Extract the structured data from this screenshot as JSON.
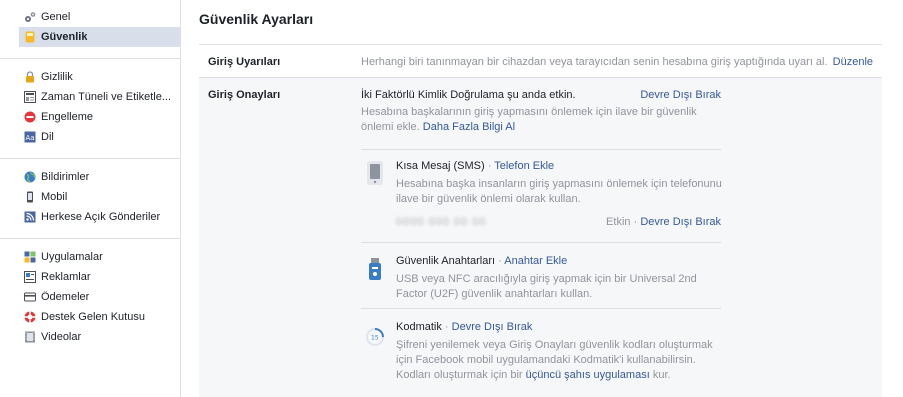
{
  "sidebar": {
    "group1": [
      {
        "label": "Genel",
        "icon": "gears-icon"
      },
      {
        "label": "Güvenlik",
        "icon": "shield-badge-icon",
        "active": true
      }
    ],
    "group2": [
      {
        "label": "Gizlilik",
        "icon": "lock-icon"
      },
      {
        "label": "Zaman Tüneli ve Etiketle...",
        "icon": "timeline-icon"
      },
      {
        "label": "Engelleme",
        "icon": "block-icon"
      },
      {
        "label": "Dil",
        "icon": "language-icon"
      }
    ],
    "group3": [
      {
        "label": "Bildirimler",
        "icon": "globe-icon"
      },
      {
        "label": "Mobil",
        "icon": "mobile-icon"
      },
      {
        "label": "Herkese Açık Gönderiler",
        "icon": "rss-icon"
      }
    ],
    "group4": [
      {
        "label": "Uygulamalar",
        "icon": "apps-icon"
      },
      {
        "label": "Reklamlar",
        "icon": "ads-icon"
      },
      {
        "label": "Ödemeler",
        "icon": "payments-icon"
      },
      {
        "label": "Destek Gelen Kutusu",
        "icon": "lifebuoy-icon"
      },
      {
        "label": "Videolar",
        "icon": "film-icon"
      }
    ]
  },
  "main": {
    "title": "Güvenlik Ayarları",
    "login_alerts": {
      "label": "Giriş Uyarıları",
      "description": "Herhangi biri tanınmayan bir cihazdan veya tarayıcıdan senin hesabına giriş yaptığında uyarı al.",
      "edit": "Düzenle"
    },
    "login_approvals": {
      "label": "Giriş Onayları",
      "status": "İki Faktörlü Kimlik Doğrulama şu anda etkin.",
      "disable": "Devre Dışı Bırak",
      "description": "Hesabına başkalarının giriş yapmasını önlemek için ilave bir güvenlik önlemi ekle.",
      "learn_more": "Daha Fazla Bilgi Al",
      "methods": {
        "sms": {
          "title": "Kısa Mesaj (SMS)",
          "sep": "·",
          "action": "Telefon Ekle",
          "description": "Hesabına başka insanların giriş yapmasını önlemek için telefonunu ilave bir güvenlik önlemi olarak kullan.",
          "phone": "0000 000 00 00",
          "state": "Etkin",
          "state_sep": "·",
          "state_action": "Devre Dışı Bırak"
        },
        "keys": {
          "title": "Güvenlik Anahtarları",
          "sep": "·",
          "action": "Anahtar Ekle",
          "description": "USB veya NFC aracılığıyla giriş yapmak için bir Universal 2nd Factor (U2F) güvenlik anahtarları kullan."
        },
        "codegen": {
          "title": "Kodmatik",
          "sep": "·",
          "action": "Devre Dışı Bırak",
          "description_pre": "Şifreni yenilemek veya Giriş Onayları güvenlik kodları oluşturmak için Facebook mobil uygulamandaki Kodmatik'i kullanabilirsin. Kodları oluşturmak için bir",
          "third_party": "üçüncü şahıs uygulaması",
          "description_post": "kur."
        }
      }
    }
  }
}
